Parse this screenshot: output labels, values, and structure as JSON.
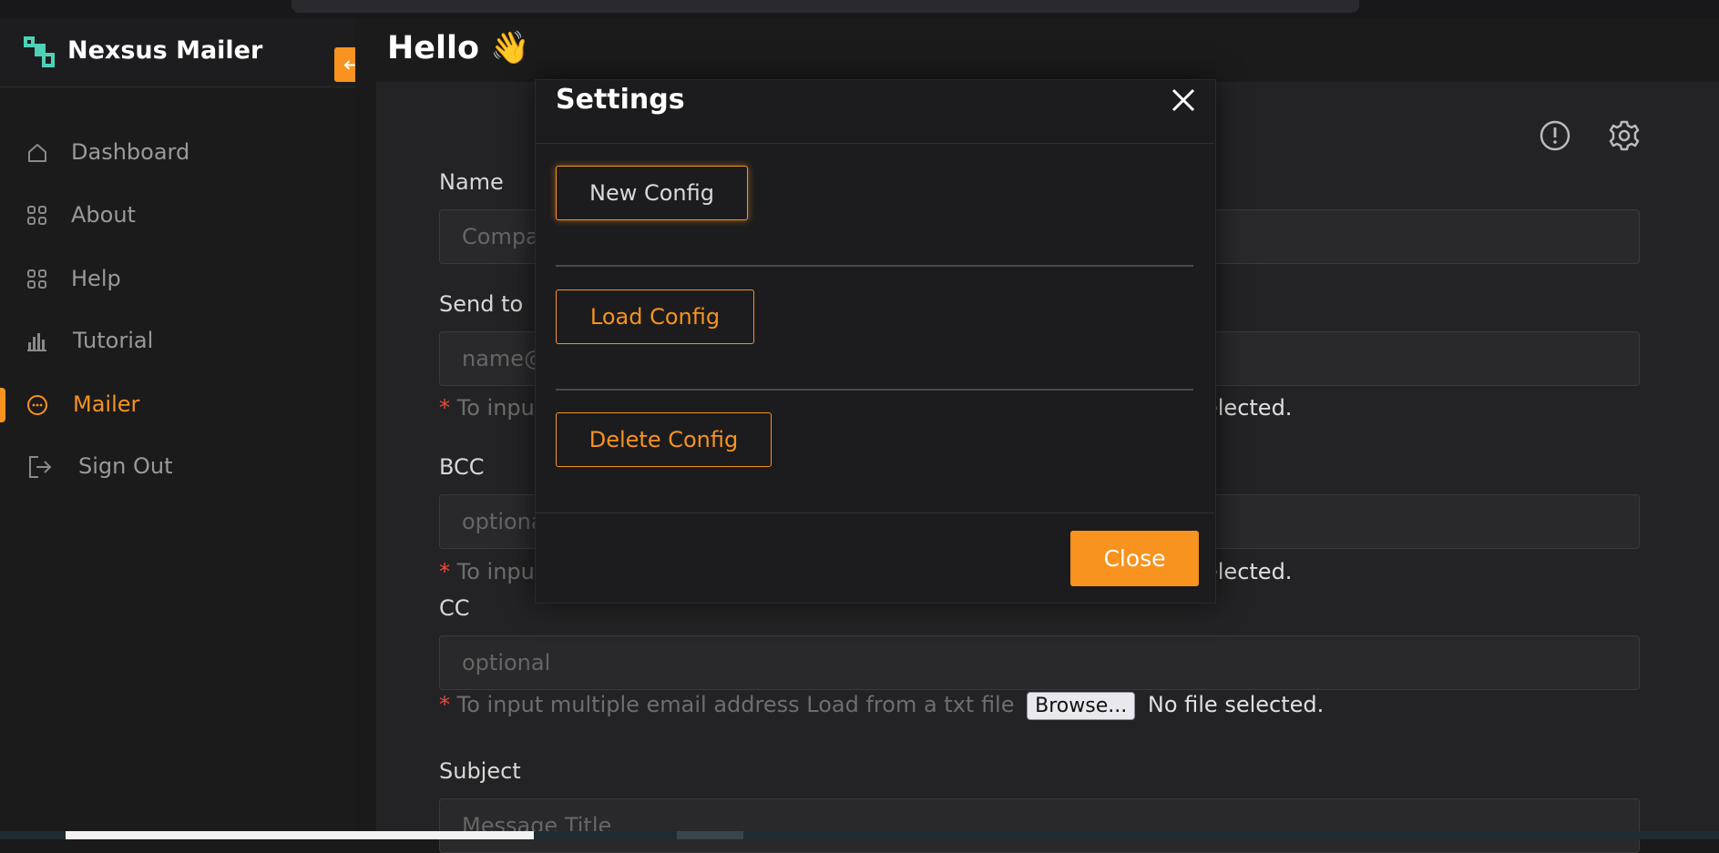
{
  "app": {
    "name": "Nexsus Mailer",
    "greeting": "Hello 👋"
  },
  "colors": {
    "accent": "#f7931e",
    "logo": "#4fd1b8",
    "background": "#1a1a1b"
  },
  "sidebar": {
    "items": [
      {
        "label": "Dashboard",
        "icon": "home-icon",
        "active": false
      },
      {
        "label": "About",
        "icon": "grid-icon",
        "active": false
      },
      {
        "label": "Help",
        "icon": "grid-icon",
        "active": false
      },
      {
        "label": "Tutorial",
        "icon": "bar-chart-icon",
        "active": false
      },
      {
        "label": "Mailer",
        "icon": "chat-icon",
        "active": true
      },
      {
        "label": "Sign Out",
        "icon": "logout-icon",
        "active": false
      }
    ]
  },
  "form": {
    "name": {
      "label": "Name",
      "placeholder": "Compa"
    },
    "send_to": {
      "label": "Send to",
      "placeholder": "name@",
      "hint_right": "elected."
    },
    "bcc": {
      "label": "BCC",
      "placeholder": "optiona",
      "hint_right": "elected."
    },
    "cc": {
      "label": "CC",
      "placeholder": "optional"
    },
    "hint_short": "To input",
    "hint_full": "To input multiple email address Load from a txt file",
    "browse_label": "Browse...",
    "no_file": "No file selected.",
    "subject": {
      "label": "Subject",
      "placeholder": "Message Title"
    }
  },
  "modal": {
    "title": "Settings",
    "new_config": "New Config",
    "load_config": "Load Config",
    "delete_config": "Delete Config",
    "close": "Close"
  }
}
